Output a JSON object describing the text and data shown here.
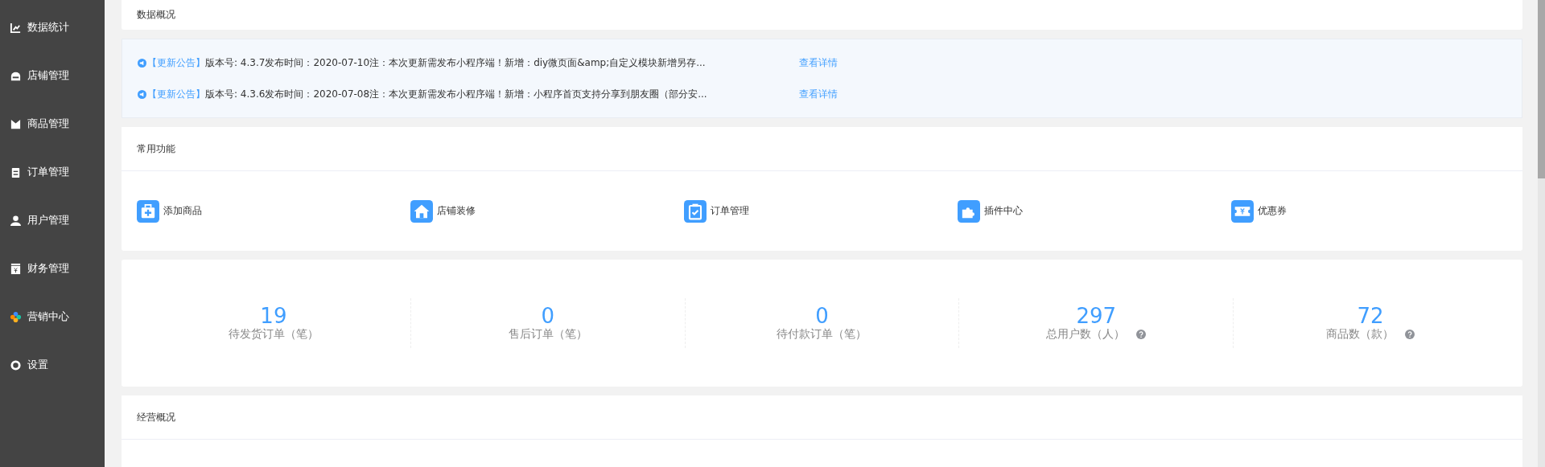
{
  "sidebar": {
    "items": [
      {
        "label": "数据统计",
        "kind": "chart"
      },
      {
        "label": "店铺管理",
        "kind": "shop"
      },
      {
        "label": "商品管理",
        "kind": "goods"
      },
      {
        "label": "订单管理",
        "kind": "order"
      },
      {
        "label": "用户管理",
        "kind": "user"
      },
      {
        "label": "财务管理",
        "kind": "finance"
      },
      {
        "label": "营销中心",
        "kind": "marketing"
      },
      {
        "label": "设置",
        "kind": "settings"
      }
    ]
  },
  "overview": {
    "title": "数据概况"
  },
  "notices": [
    {
      "tag": "【更新公告】",
      "text": "版本号: 4.3.7发布时间：2020-07-10注：本次更新需发布小程序端！新增：diy微页面&amp;自定义模块新增另存...",
      "link": "查看详情"
    },
    {
      "tag": "【更新公告】",
      "text": "版本号: 4.3.6发布时间：2020-07-08注：本次更新需发布小程序端！新增：小程序首页支持分享到朋友圈（部分安...",
      "link": "查看详情"
    }
  ],
  "shortcuts": {
    "title": "常用功能",
    "items": [
      {
        "label": "添加商品",
        "kind": "add"
      },
      {
        "label": "店铺装修",
        "kind": "home"
      },
      {
        "label": "订单管理",
        "kind": "clipboard"
      },
      {
        "label": "插件中心",
        "kind": "plugin"
      },
      {
        "label": "优惠券",
        "kind": "coupon"
      }
    ]
  },
  "stats": [
    {
      "value": "19",
      "label": "待发货订单（笔）",
      "kind": "plain"
    },
    {
      "value": "0",
      "label": "售后订单（笔）",
      "kind": "plain"
    },
    {
      "value": "0",
      "label": "待付款订单（笔）",
      "kind": "plain"
    },
    {
      "value": "297",
      "label": "总用户数（人）",
      "kind": "help"
    },
    {
      "value": "72",
      "label": "商品数（款）",
      "kind": "help"
    }
  ],
  "business": {
    "title": "经营概况"
  }
}
